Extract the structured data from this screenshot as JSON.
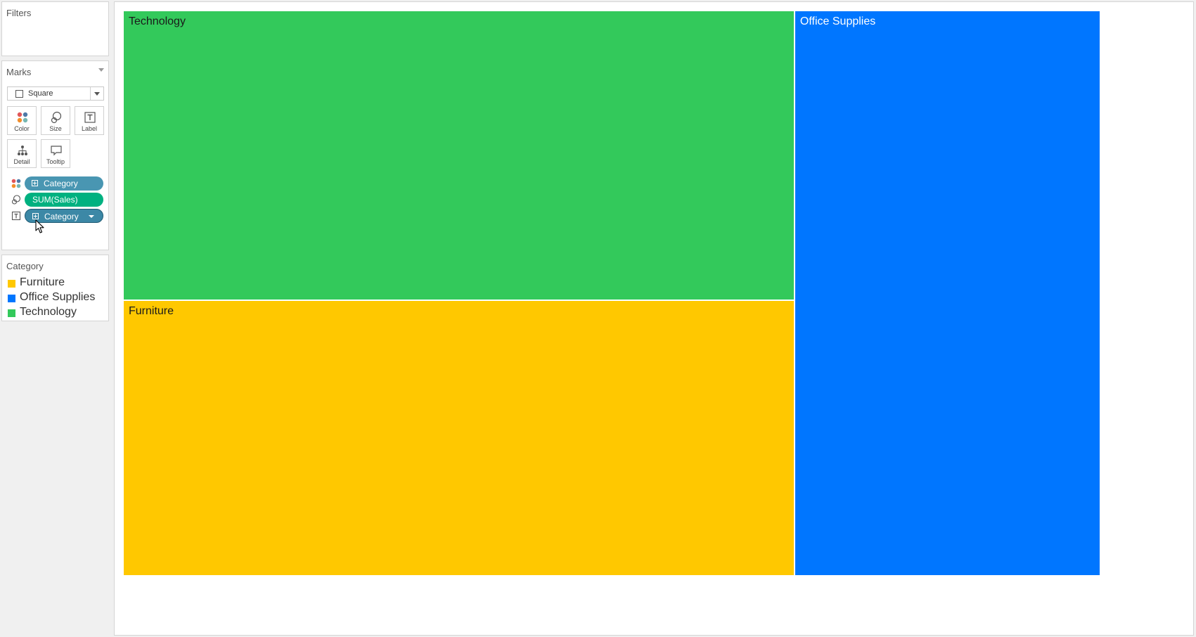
{
  "sidebar": {
    "filters_title": "Filters",
    "marks_title": "Marks",
    "mark_type": "Square",
    "buttons": [
      {
        "label": "Color",
        "icon": "color-dots-icon"
      },
      {
        "label": "Size",
        "icon": "size-circles-icon"
      },
      {
        "label": "Label",
        "icon": "text-label-icon"
      },
      {
        "label": "Detail",
        "icon": "detail-hierarchy-icon"
      },
      {
        "label": "Tooltip",
        "icon": "tooltip-bubble-icon"
      }
    ],
    "pills": [
      {
        "encoding": "color",
        "icon": "color-dots-icon",
        "field": "Category",
        "color": "#4996b2"
      },
      {
        "encoding": "size",
        "icon": "size-circles-icon",
        "field": "SUM(Sales)",
        "color": "#00b180"
      },
      {
        "encoding": "label",
        "icon": "text-label-icon",
        "field": "Category",
        "color": "#4996b2"
      }
    ]
  },
  "legend": {
    "title": "Category",
    "items": [
      {
        "name": "Furniture",
        "color": "#ffc800"
      },
      {
        "name": "Office Supplies",
        "color": "#0076ff"
      },
      {
        "name": "Technology",
        "color": "#33c95b"
      }
    ]
  },
  "chart_data": {
    "type": "treemap",
    "size_measure": "SUM(Sales)",
    "color_dimension": "Category",
    "items": [
      {
        "category": "Technology",
        "relative_size": 0.352,
        "color": "#33c95b",
        "label_color": "#1a1a1a"
      },
      {
        "category": "Office Supplies",
        "relative_size": 0.313,
        "color": "#0076ff",
        "label_color": "#ffffff"
      },
      {
        "category": "Furniture",
        "relative_size": 0.335,
        "color": "#ffc800",
        "label_color": "#1a1a1a"
      }
    ]
  }
}
